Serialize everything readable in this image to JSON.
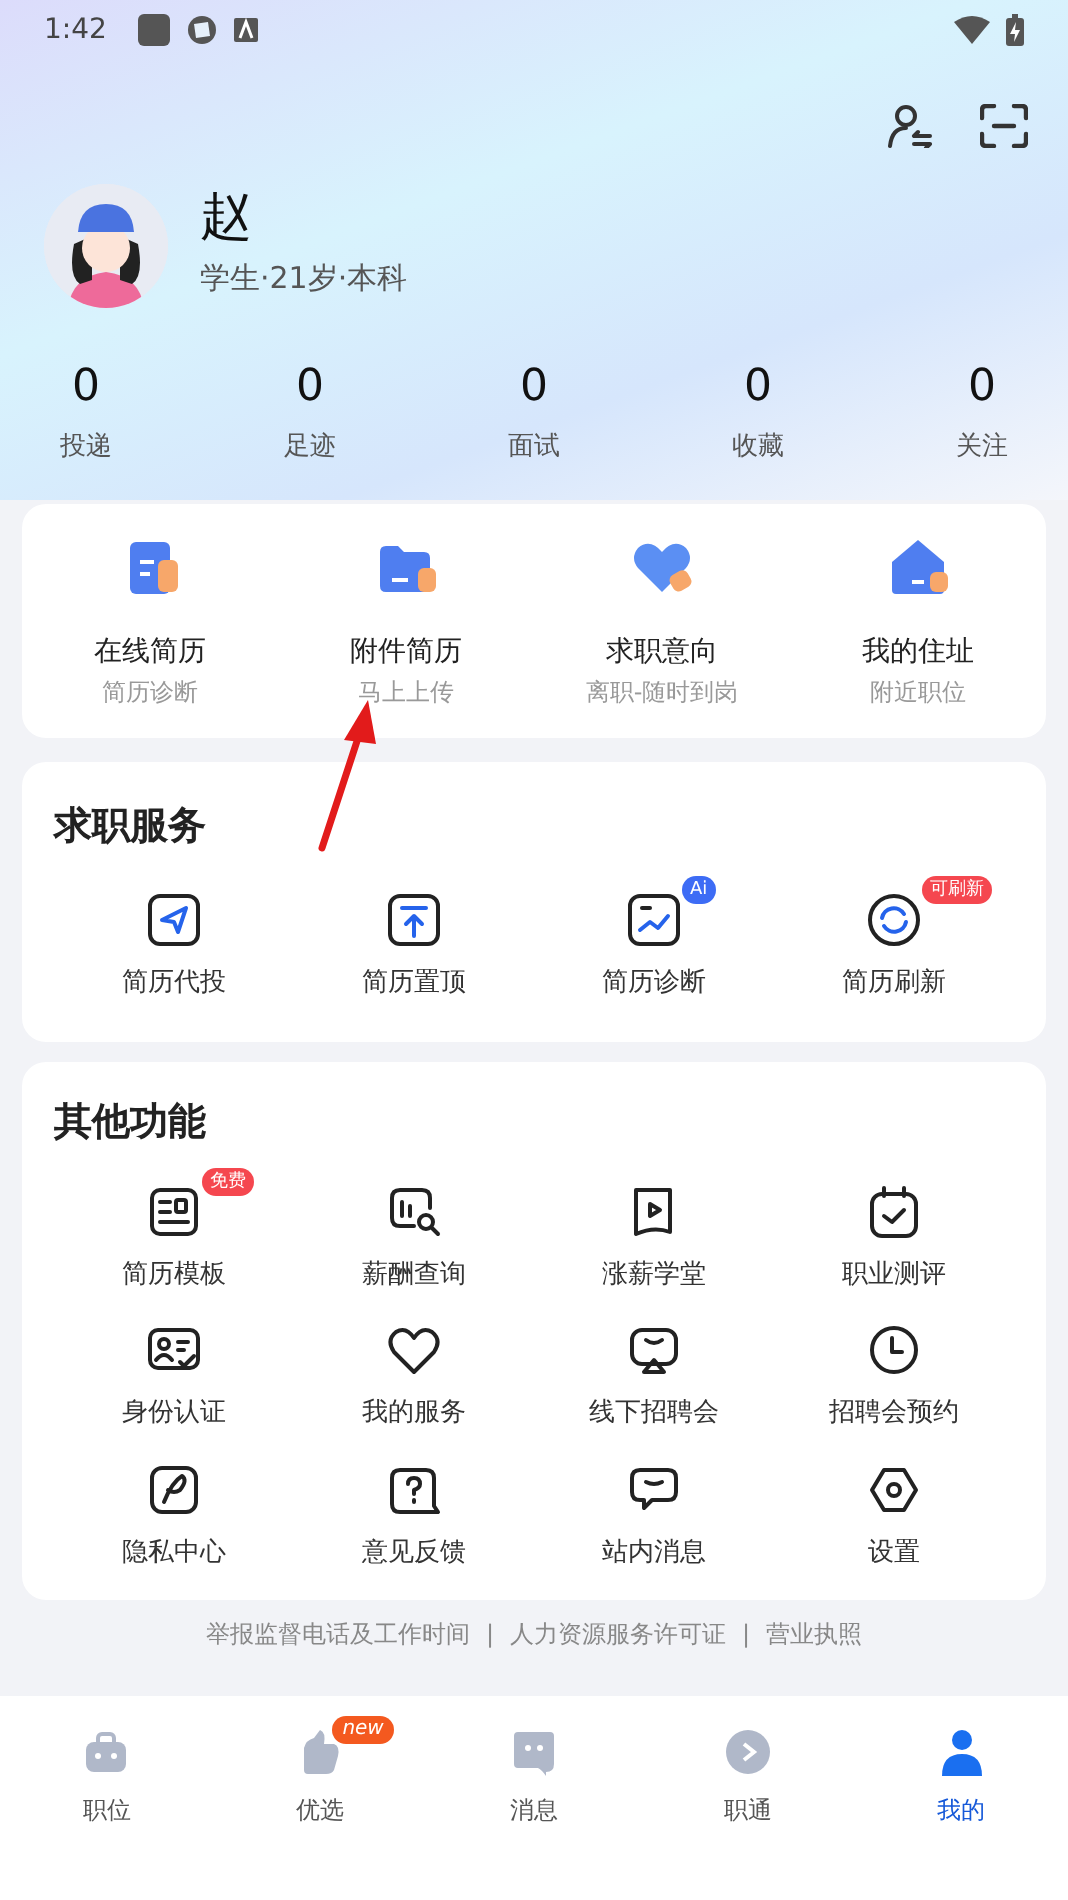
{
  "status_bar": {
    "time": "1:42"
  },
  "profile": {
    "name": "赵",
    "details": "学生·21岁·本科"
  },
  "stats": [
    {
      "value": "0",
      "label": "投递"
    },
    {
      "value": "0",
      "label": "足迹"
    },
    {
      "value": "0",
      "label": "面试"
    },
    {
      "value": "0",
      "label": "收藏"
    },
    {
      "value": "0",
      "label": "关注"
    }
  ],
  "resume_shortcuts": [
    {
      "title": "在线简历",
      "subtitle": "简历诊断"
    },
    {
      "title": "附件简历",
      "subtitle": "马上上传"
    },
    {
      "title": "求职意向",
      "subtitle": "离职-随时到岗"
    },
    {
      "title": "我的住址",
      "subtitle": "附近职位"
    }
  ],
  "job_services": {
    "title": "求职服务",
    "items": [
      {
        "label": "简历代投"
      },
      {
        "label": "简历置顶"
      },
      {
        "label": "简历诊断",
        "badge": {
          "text": "Ai",
          "color": "#3d6cf5"
        }
      },
      {
        "label": "简历刷新",
        "badge": {
          "text": "可刷新",
          "color": "#f5474f"
        }
      }
    ]
  },
  "other_functions": {
    "title": "其他功能",
    "items": [
      {
        "label": "简历模板",
        "badge": {
          "text": "免费",
          "color": "#f5474f"
        }
      },
      {
        "label": "薪酬查询"
      },
      {
        "label": "涨薪学堂"
      },
      {
        "label": "职业测评"
      },
      {
        "label": "身份认证"
      },
      {
        "label": "我的服务"
      },
      {
        "label": "线下招聘会"
      },
      {
        "label": "招聘会预约"
      },
      {
        "label": "隐私中心"
      },
      {
        "label": "意见反馈"
      },
      {
        "label": "站内消息"
      },
      {
        "label": "设置"
      }
    ]
  },
  "footer": {
    "links": [
      "举报监督电话及工作时间",
      "人力资源服务许可证",
      "营业执照"
    ],
    "separator": "|"
  },
  "tab_bar": [
    {
      "label": "职位",
      "selected": false
    },
    {
      "label": "优选",
      "selected": false,
      "badge": "new"
    },
    {
      "label": "消息",
      "selected": false
    },
    {
      "label": "职通",
      "selected": false
    },
    {
      "label": "我的",
      "selected": true
    }
  ]
}
